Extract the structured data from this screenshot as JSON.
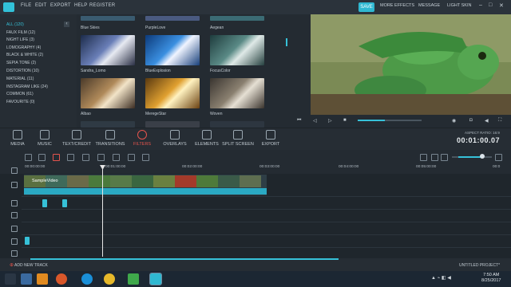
{
  "menu": {
    "items": [
      "FILE",
      "EDIT",
      "EXPORT",
      "HELP",
      "REGISTER"
    ],
    "save": "SAVE",
    "right": [
      "MORE EFFECTS",
      "MESSAGE",
      "LIGHT SKIN"
    ]
  },
  "categories": [
    "ALL (120)",
    "FAUX FILM (12)",
    "NIGHT LIFE (3)",
    "LOMOGRAPHY (4)",
    "BLACK & WHITE (2)",
    "SEPIA TONE (2)",
    "DISTORTION (10)",
    "MATERIAL (11)",
    "INSTAGRAM LIKE (24)",
    "COMMON (61)",
    "FAVOURITE (0)"
  ],
  "filters": [
    "Blue Skies",
    "PurpleLove",
    "Aegean",
    "Sandra_Lomo",
    "BlueExplosion",
    "FocusColor",
    "Albao",
    "MeregeStar",
    "Woven"
  ],
  "toolbar": {
    "tools": [
      "MEDIA",
      "MUSIC",
      "TEXT/CREDIT",
      "TRANSITIONS",
      "FILTERS",
      "OVERLAYS",
      "ELEMENTS",
      "SPLIT SCREEN",
      "EXPORT"
    ],
    "aspect": "ASPECT RATIO: 16:9",
    "timecode": "00:01:00.07"
  },
  "timeline": {
    "ticks": [
      "00:00:00:00",
      "00:01:00:00",
      "00:02:00:00",
      "00:03:00:00",
      "00:04:00:00",
      "00:05:00:00",
      "00:0"
    ],
    "clip_title": "SampleVideo",
    "add_track": "ADD NEW TRACK",
    "project": "UNTITLED PROJECT*"
  },
  "clock": {
    "time": "7:50 AM",
    "date": "8/25/2017"
  },
  "colors": {
    "accent": "#36c1d8",
    "filters_active": "#e4544d"
  }
}
